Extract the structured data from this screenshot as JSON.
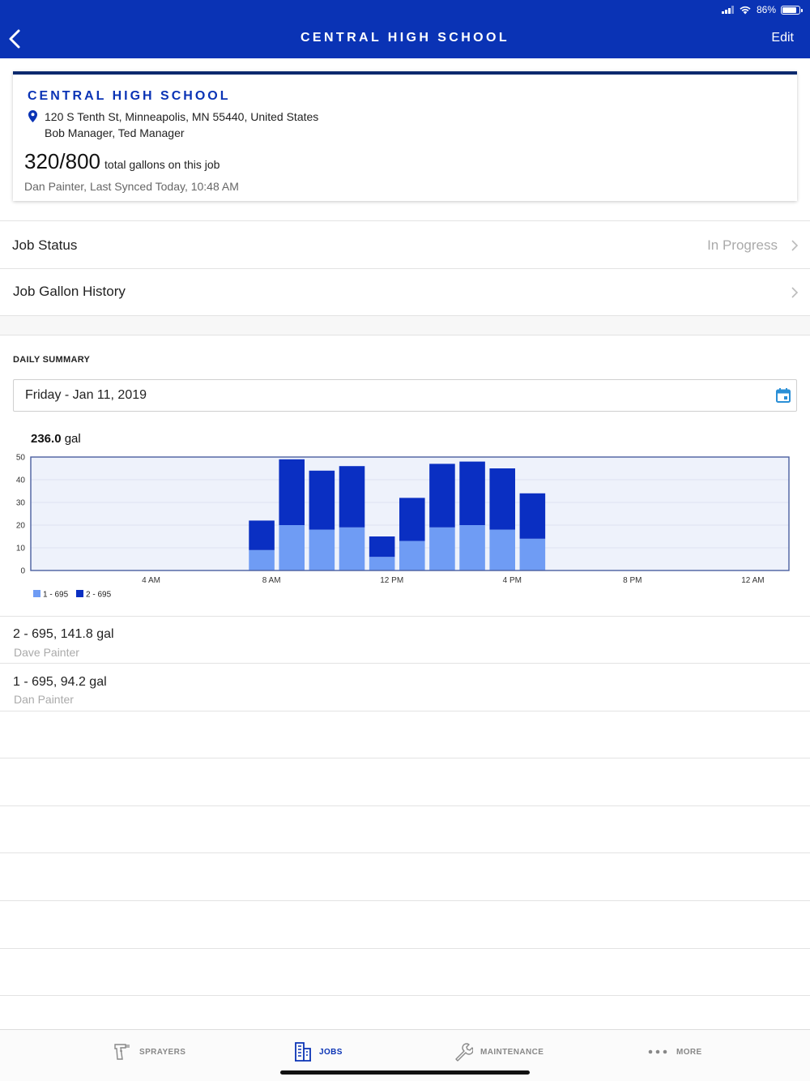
{
  "status_bar": {
    "battery": "86%"
  },
  "nav": {
    "title": "CENTRAL HIGH SCHOOL",
    "edit_label": "Edit"
  },
  "job_card": {
    "title": "CENTRAL HIGH SCHOOL",
    "address": "120 S Tenth St, Minneapolis, MN 55440, United States",
    "managers": "Bob Manager, Ted Manager",
    "gallons_used": "320",
    "gallons_total": "800",
    "gallons_text": "total gallons on this job",
    "synced": "Dan Painter, Last Synced Today, 10:48 AM"
  },
  "rows": [
    {
      "label": "Job Status",
      "value": "In Progress"
    },
    {
      "label": "Job Gallon History",
      "value": ""
    }
  ],
  "daily_summary": {
    "heading": "DAILY SUMMARY",
    "date": "Friday - Jan 11, 2019",
    "total_value": "236.0",
    "total_unit": "gal"
  },
  "chart_data": {
    "type": "bar",
    "stacked": true,
    "title": "",
    "xlabel": "",
    "ylabel": "",
    "ylim": [
      0,
      50
    ],
    "y_ticks": [
      "50",
      "40",
      "30",
      "20",
      "10",
      "0"
    ],
    "x_tick_labels": [
      "4 AM",
      "8 AM",
      "12 PM",
      "4 PM",
      "8 PM",
      "12 AM"
    ],
    "x_tick_hours": [
      4,
      8,
      12,
      16,
      20,
      24
    ],
    "x_range_hours": [
      0,
      25.2
    ],
    "categories": [
      "7:00",
      "8:00",
      "9:00",
      "10:00",
      "11:00",
      "12:00",
      "13:00",
      "14:00",
      "15:00",
      "16:00",
      "17:00"
    ],
    "category_start_hours": [
      7.25,
      8.25,
      9.25,
      10.25,
      11.25,
      12.25,
      13.25,
      14.25,
      15.25,
      16.25,
      17.25
    ],
    "series": [
      {
        "name": "1 - 695",
        "color": "#6f9cf4",
        "values": [
          9,
          20,
          18,
          19,
          6,
          13,
          19,
          20,
          18,
          14,
          0
        ]
      },
      {
        "name": "2 - 695",
        "color": "#0a2fc2",
        "values": [
          13,
          29,
          26,
          27,
          9,
          19,
          28,
          28,
          27,
          20,
          0
        ]
      }
    ],
    "legend_position": "bottom-left",
    "grid": true
  },
  "sprayers": [
    {
      "title": "2 - 695, 141.8 gal",
      "user": "Dave Painter"
    },
    {
      "title": "1 - 695, 94.2 gal",
      "user": "Dan Painter"
    }
  ],
  "tabs": [
    {
      "label": "SPRAYERS",
      "icon": "spray-gun-icon"
    },
    {
      "label": "JOBS",
      "icon": "building-icon"
    },
    {
      "label": "MAINTENANCE",
      "icon": "wrench-icon"
    },
    {
      "label": "MORE",
      "icon": "more-dots-icon"
    }
  ],
  "colors": {
    "brand": "#0a33b5",
    "series_1": "#6f9cf4",
    "series_2": "#0a2fc2",
    "plot_bg": "#eef2fb"
  }
}
